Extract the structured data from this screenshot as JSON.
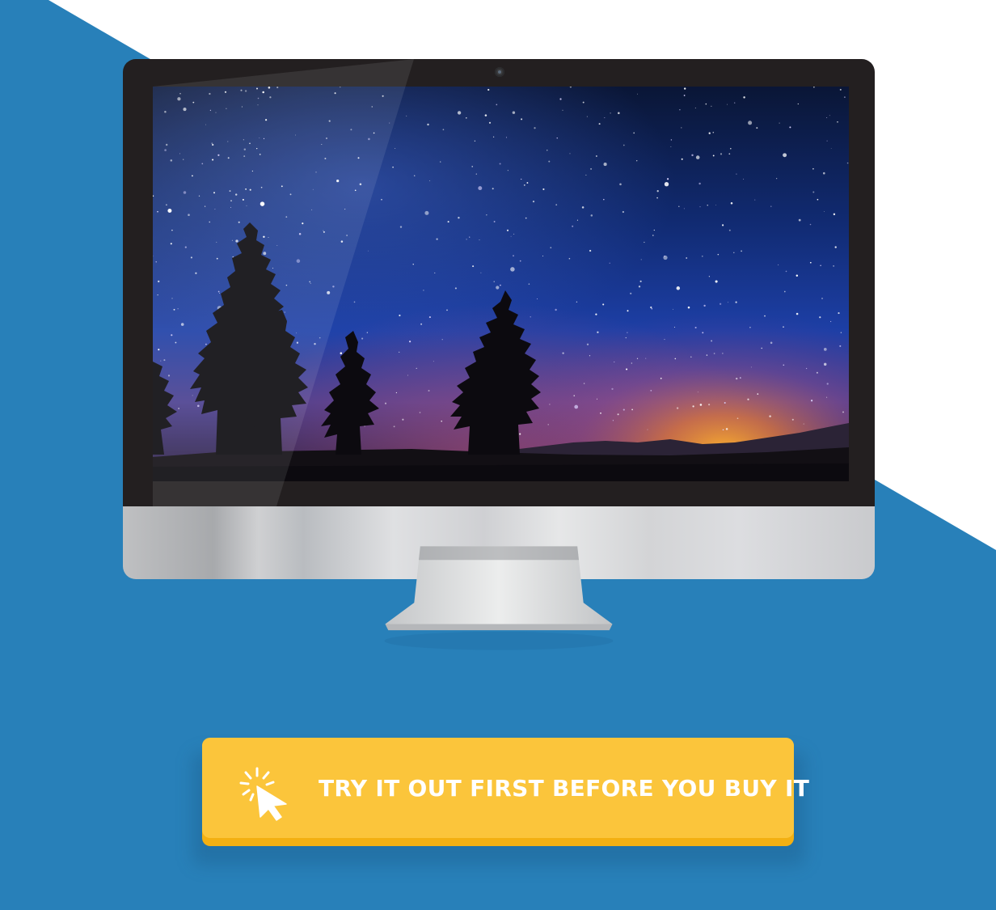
{
  "colors": {
    "background_blue": "#2880b9",
    "background_white": "#ffffff",
    "button_face": "#fbc53b",
    "button_edge": "#f3b012",
    "button_text": "#ffffff",
    "bezel": "#231f20",
    "chin_silver": "#d1d3d4"
  },
  "monitor": {
    "screen_content": "starry-night-wallpaper"
  },
  "cta": {
    "label": "TRY IT OUT FIRST BEFORE YOU BUY IT",
    "icon": "cursor-click-icon"
  }
}
